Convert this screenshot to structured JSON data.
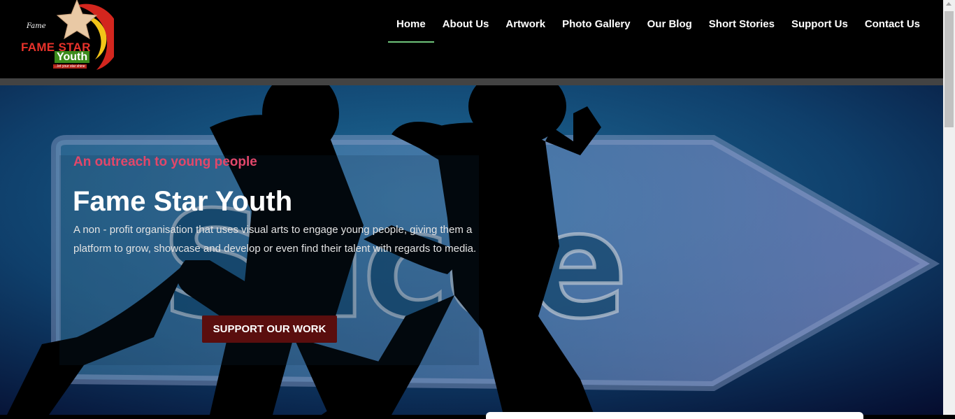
{
  "brand": {
    "logo_line1": "FAME STAR",
    "logo_line2": "Youth",
    "logo_tagline": "...let your star shine"
  },
  "nav": {
    "items": [
      {
        "label": "Home",
        "active": true
      },
      {
        "label": "About Us"
      },
      {
        "label": "Artwork"
      },
      {
        "label": "Photo Gallery"
      },
      {
        "label": "Our Blog"
      },
      {
        "label": "Short Stories"
      },
      {
        "label": "Support Us"
      },
      {
        "label": "Contact Us"
      }
    ]
  },
  "hero": {
    "kicker": "An outreach to young people",
    "title": "Fame Star Youth",
    "description": "A non - profit organisation that uses visual arts to engage young people, giving them a platform to grow, showcase and develop or even find their talent with regards to media.",
    "cta_label": "SUPPORT OUR WORK",
    "background_word": "Success"
  },
  "colors": {
    "kicker": "#e2476a",
    "nav_active_underline": "#6fc47a",
    "cta_bg": "#5a0e0e"
  }
}
